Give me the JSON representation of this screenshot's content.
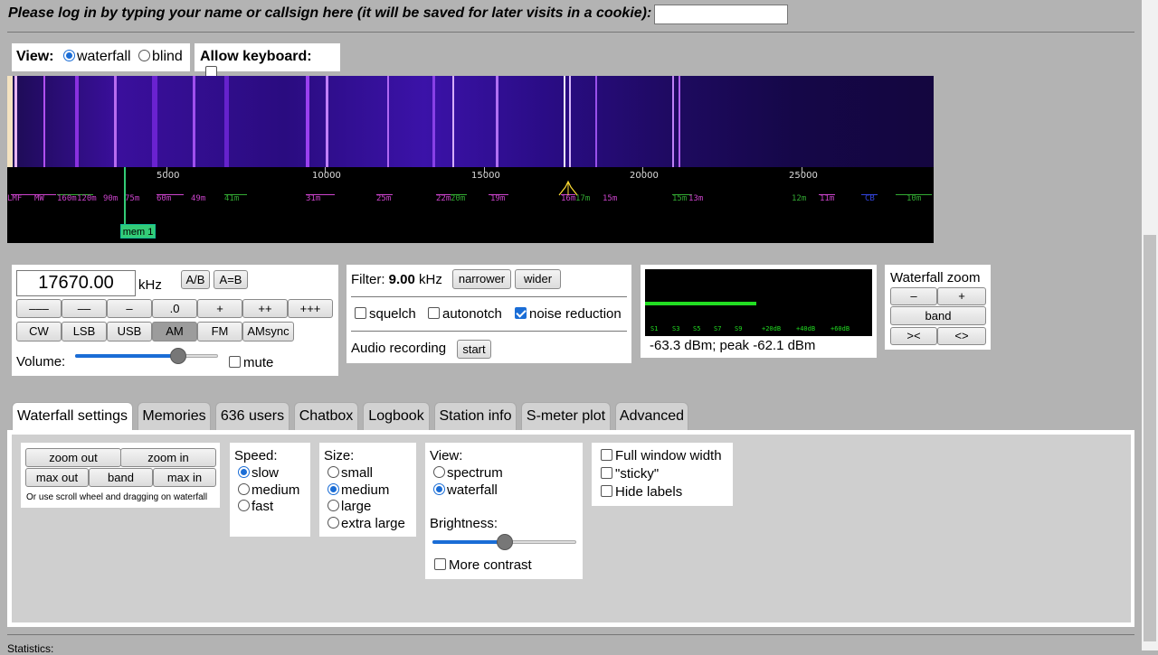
{
  "login": {
    "prompt": "Please log in by typing your name or callsign here (it will be saved for later visits in a cookie):",
    "value": ""
  },
  "view": {
    "label": "View:",
    "options": [
      "waterfall",
      "blind"
    ],
    "selected": "waterfall",
    "keyboard_label": "Allow keyboard:"
  },
  "scale": {
    "ticks": [
      "5000",
      "10000",
      "15000",
      "20000",
      "25000"
    ],
    "bands": [
      {
        "label": "LMF",
        "color": "#cc44cc"
      },
      {
        "label": "MW",
        "color": "#cc44cc"
      },
      {
        "label": "160m",
        "color": "#33aa33"
      },
      {
        "label": "120m",
        "color": "#cc44cc"
      },
      {
        "label": "90m",
        "color": "#cc44cc"
      },
      {
        "label": "75m",
        "color": "#cc44cc"
      },
      {
        "label": "60m",
        "color": "#cc44cc"
      },
      {
        "label": "49m",
        "color": "#cc44cc"
      },
      {
        "label": "41m",
        "color": "#33aa33"
      },
      {
        "label": "31m",
        "color": "#cc44cc"
      },
      {
        "label": "25m",
        "color": "#cc44cc"
      },
      {
        "label": "22m",
        "color": "#cc44cc"
      },
      {
        "label": "20m",
        "color": "#33aa33"
      },
      {
        "label": "19m",
        "color": "#cc44cc"
      },
      {
        "label": "16m",
        "color": "#cc44cc"
      },
      {
        "label": "17m",
        "color": "#33aa33"
      },
      {
        "label": "15m",
        "color": "#cc44cc"
      },
      {
        "label": "15m",
        "color": "#33aa33"
      },
      {
        "label": "13m",
        "color": "#cc44cc"
      },
      {
        "label": "12m",
        "color": "#33aa33"
      },
      {
        "label": "11m",
        "color": "#cc44cc"
      },
      {
        "label": "CB",
        "color": "#3344dd"
      },
      {
        "label": "10m",
        "color": "#33aa33"
      }
    ],
    "memory_label": "mem 1"
  },
  "tuning": {
    "frequency": "17670.00",
    "unit": "kHz",
    "ab": "A/B",
    "a_eq_b": "A=B",
    "step_buttons": [
      "–––",
      "––",
      "–",
      ".0",
      "+",
      "++",
      "+++"
    ],
    "modes": [
      "CW",
      "LSB",
      "USB",
      "AM",
      "FM",
      "AMsync"
    ],
    "active_mode": "AM",
    "volume_label": "Volume:",
    "volume_level": 0.72,
    "mute_label": "mute"
  },
  "filter": {
    "label": "Filter:",
    "value": "9.00",
    "unit": "kHz",
    "narrower": "narrower",
    "wider": "wider",
    "squelch": "squelch",
    "autonotch": "autonotch",
    "noise_reduction": "noise reduction",
    "noise_reduction_on": true,
    "recording_label": "Audio recording",
    "start": "start"
  },
  "smeter": {
    "labels": [
      "S1",
      "S3",
      "S5",
      "S7",
      "S9",
      "+20dB",
      "+40dB",
      "+60dB"
    ],
    "level": 0.49,
    "readout": "-63.3 dBm; peak  -62.1 dBm"
  },
  "waterfall_zoom": {
    "title": "Waterfall zoom",
    "minus": "–",
    "plus": "+",
    "band": "band",
    "left": ">< ",
    "right": "<>"
  },
  "tabs": [
    "Waterfall settings",
    "Memories",
    "636 users",
    "Chatbox",
    "Logbook",
    "Station info",
    "S-meter plot",
    "Advanced"
  ],
  "active_tab": "Waterfall settings",
  "settings": {
    "zoom_out": "zoom out",
    "zoom_in": "zoom in",
    "max_out": "max out",
    "band": "band",
    "max_in": "max in",
    "hint": "Or use scroll wheel and dragging on waterfall",
    "speed_label": "Speed:",
    "speed_options": [
      "slow",
      "medium",
      "fast"
    ],
    "speed_selected": "slow",
    "size_label": "Size:",
    "size_options": [
      "small",
      "medium",
      "large",
      "extra large"
    ],
    "size_selected": "medium",
    "view_label": "View:",
    "view_options": [
      "spectrum",
      "waterfall"
    ],
    "view_selected": "waterfall",
    "brightness_label": "Brightness:",
    "brightness_level": 0.5,
    "more_contrast": "More contrast",
    "full_width": "Full window width",
    "sticky": "\"sticky\"",
    "hide_labels": "Hide labels"
  },
  "statistics_label": "Statistics:"
}
